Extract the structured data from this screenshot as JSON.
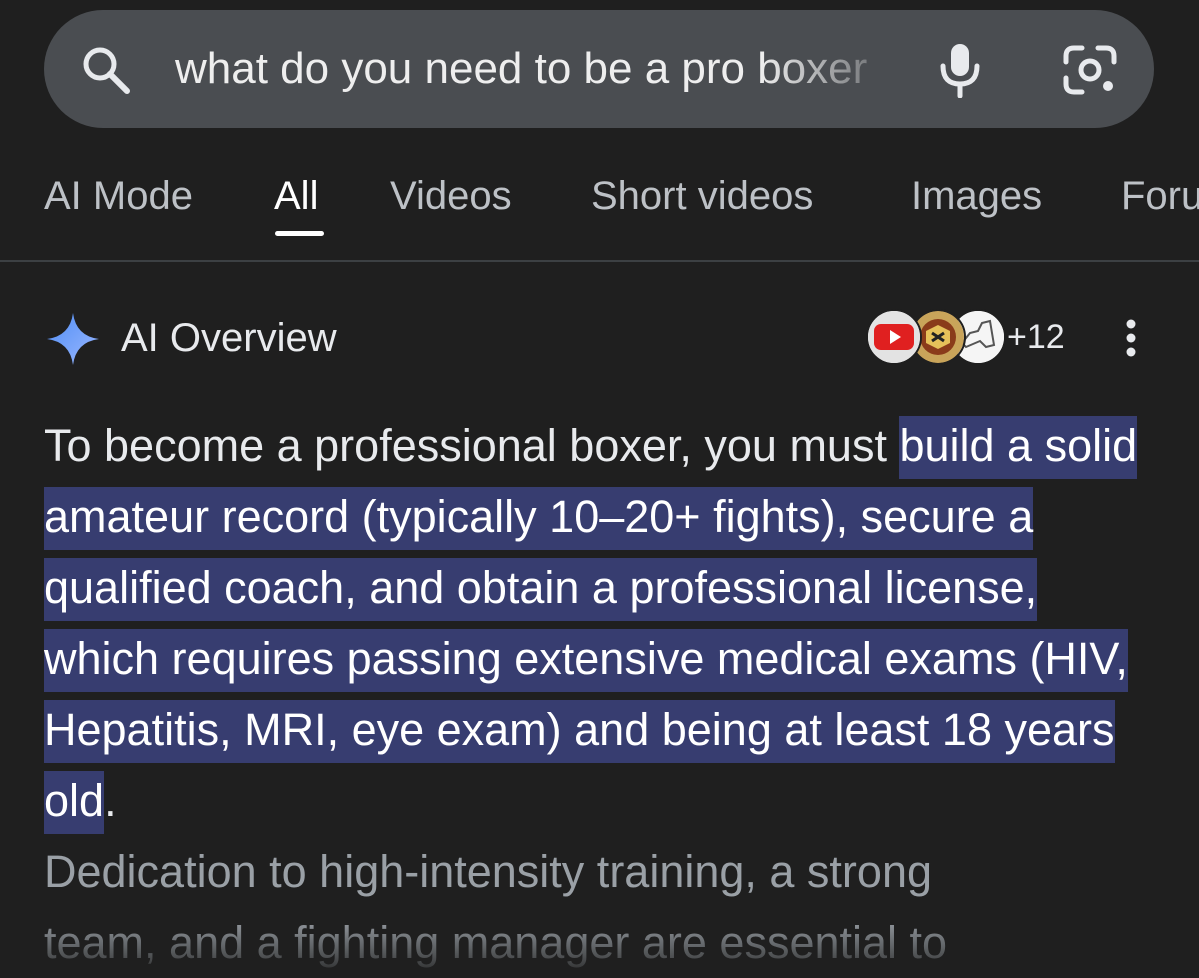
{
  "search": {
    "query": "what do you need to be a pro boxer",
    "icons": {
      "search": "search-icon",
      "mic": "mic-icon",
      "lens": "lens-icon"
    }
  },
  "tabs": [
    {
      "label": "AI Mode",
      "active": false
    },
    {
      "label": "All",
      "active": true
    },
    {
      "label": "Videos",
      "active": false
    },
    {
      "label": "Short videos",
      "active": false
    },
    {
      "label": "Images",
      "active": false
    },
    {
      "label": "Forums",
      "active": false
    }
  ],
  "ai_overview": {
    "title": "AI Overview",
    "source_count": "+12",
    "sources": [
      "youtube-icon",
      "maryland-seal-icon",
      "new-york-map-icon"
    ],
    "text_intro": "To become a professional boxer, you must ",
    "text_highlight": "build a solid amateur record (typically 10–20+ fights), secure a qualified coach, and obtain a professional license, which requires passing extensive medical exams (HIV, Hepatitis, MRI, eye exam) and being at least 18 years old",
    "text_period": ".",
    "text_dim": "Dedication to high-intensity training, a strong",
    "text_faded": "team, and a fighting manager are essential to"
  },
  "colors": {
    "background": "#1f1f1f",
    "search_bar": "#4a4d51",
    "highlight": "#373d70",
    "text": "#e8eaed",
    "muted_text": "#9aa0a6"
  }
}
